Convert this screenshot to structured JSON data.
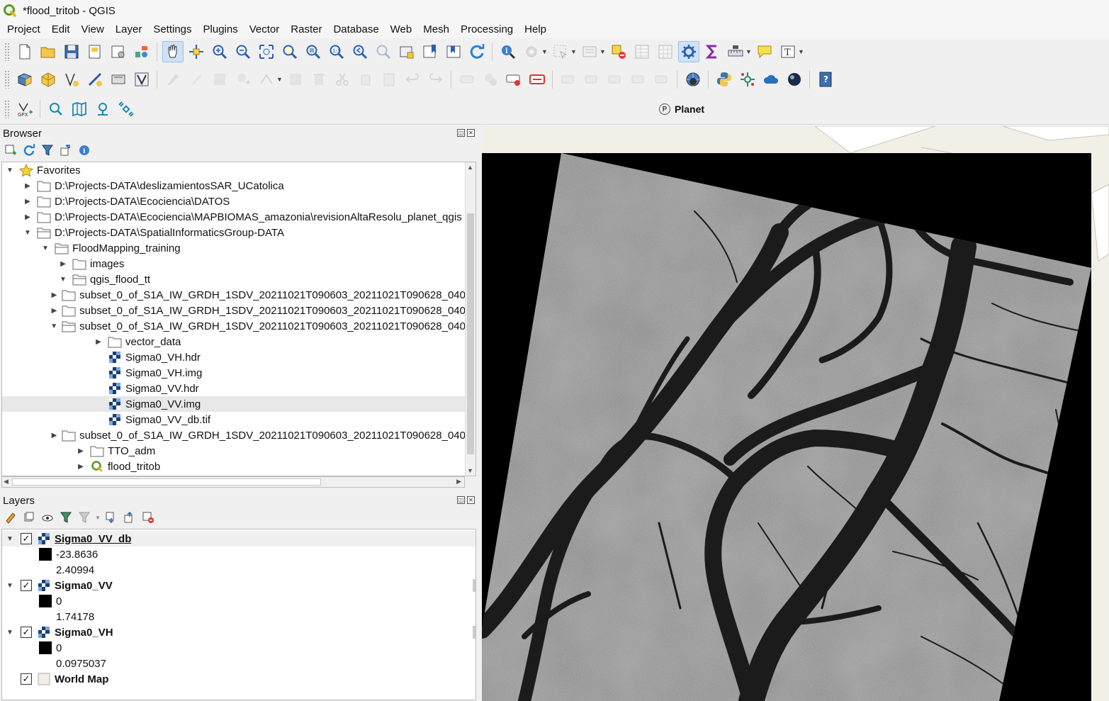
{
  "window": {
    "title": "*flood_tritob - QGIS"
  },
  "menu": {
    "items": [
      {
        "label": "Project",
        "u": "P",
        "rest": "roject"
      },
      {
        "label": "Edit",
        "u": "E",
        "rest": "dit"
      },
      {
        "label": "View",
        "u": "V",
        "rest": "iew"
      },
      {
        "label": "Layer",
        "u": "L",
        "rest": "ayer"
      },
      {
        "label": "Settings",
        "u": "S",
        "rest": "ettings"
      },
      {
        "label": "Plugins",
        "u": "P",
        "rest": "lugins"
      },
      {
        "label": "Vector",
        "u": "V",
        "rest": "ector"
      },
      {
        "label": "Raster",
        "u": "R",
        "rest": "aster"
      },
      {
        "label": "Database",
        "u": "D",
        "rest": "atabase"
      },
      {
        "label": "Web",
        "u": "W",
        "rest": "eb"
      },
      {
        "label": "Mesh",
        "u": "M",
        "rest": "esh"
      },
      {
        "label": "Processing",
        "u": "",
        "rest": "Processing"
      },
      {
        "label": "Help",
        "u": "H",
        "rest": "elp"
      }
    ]
  },
  "plugin_bar": {
    "planet_label": "Planet",
    "planet_glyph": "P"
  },
  "browser": {
    "title": "Browser",
    "items": [
      {
        "label": "Favorites",
        "icon": "star-icon",
        "arrow": "▼"
      },
      {
        "label": "D:\\Projects-DATA\\deslizamientosSAR_UCatolica",
        "icon": "folder-icon",
        "arrow": "▶"
      },
      {
        "label": "D:\\Projects-DATA\\Ecociencia\\DATOS",
        "icon": "folder-icon",
        "arrow": "▶"
      },
      {
        "label": "D:\\Projects-DATA\\Ecociencia\\MAPBIOMAS_amazonia\\revisionAltaResolu_planet_qgis",
        "icon": "folder-icon",
        "arrow": "▶"
      },
      {
        "label": "D:\\Projects-DATA\\SpatialInformaticsGroup-DATA",
        "icon": "folder-open-icon",
        "arrow": "▼"
      },
      {
        "label": "FloodMapping_training",
        "icon": "folder-open-icon",
        "arrow": "▼"
      },
      {
        "label": "images",
        "icon": "folder-icon",
        "arrow": "▶"
      },
      {
        "label": "qgis_flood_tt",
        "icon": "folder-open-icon",
        "arrow": "▼"
      },
      {
        "label": "subset_0_of_S1A_IW_GRDH_1SDV_20211021T090603_20211021T090628_040",
        "icon": "folder-icon",
        "arrow": "▶"
      },
      {
        "label": "subset_0_of_S1A_IW_GRDH_1SDV_20211021T090603_20211021T090628_040",
        "icon": "folder-icon",
        "arrow": "▶"
      },
      {
        "label": "subset_0_of_S1A_IW_GRDH_1SDV_20211021T090603_20211021T090628_040",
        "icon": "folder-open-icon",
        "arrow": "▼"
      },
      {
        "label": "vector_data",
        "icon": "folder-icon",
        "arrow": "▶"
      },
      {
        "label": "Sigma0_VH.hdr",
        "icon": "raster-icon",
        "arrow": ""
      },
      {
        "label": "Sigma0_VH.img",
        "icon": "raster-icon",
        "arrow": ""
      },
      {
        "label": "Sigma0_VV.hdr",
        "icon": "raster-icon",
        "arrow": ""
      },
      {
        "label": "Sigma0_VV.img",
        "icon": "raster-icon",
        "arrow": ""
      },
      {
        "label": "Sigma0_VV_db.tif",
        "icon": "raster-icon",
        "arrow": ""
      },
      {
        "label": "subset_0_of_S1A_IW_GRDH_1SDV_20211021T090603_20211021T090628_040",
        "icon": "folder-icon",
        "arrow": "▶"
      },
      {
        "label": "TTO_adm",
        "icon": "folder-icon",
        "arrow": "▶"
      },
      {
        "label": "flood_tritob",
        "icon": "qgis-project-icon",
        "arrow": "▶"
      }
    ]
  },
  "layers": {
    "title": "Layers",
    "items": [
      {
        "name": "Sigma0_VV_db",
        "checked": "✓",
        "min": "-23.8636",
        "max": "2.40994"
      },
      {
        "name": "Sigma0_VV",
        "checked": "✓",
        "min": "0",
        "max": "1.74178"
      },
      {
        "name": "Sigma0_VH",
        "checked": "✓",
        "min": "0",
        "max": "0.0975037"
      },
      {
        "name": "World Map",
        "checked": "✓"
      }
    ]
  },
  "colors": {
    "map_background": "#f1efe6",
    "raster_nodata": "#000000",
    "selection": "#e8e8e8",
    "accent": "#3c8a2e"
  }
}
